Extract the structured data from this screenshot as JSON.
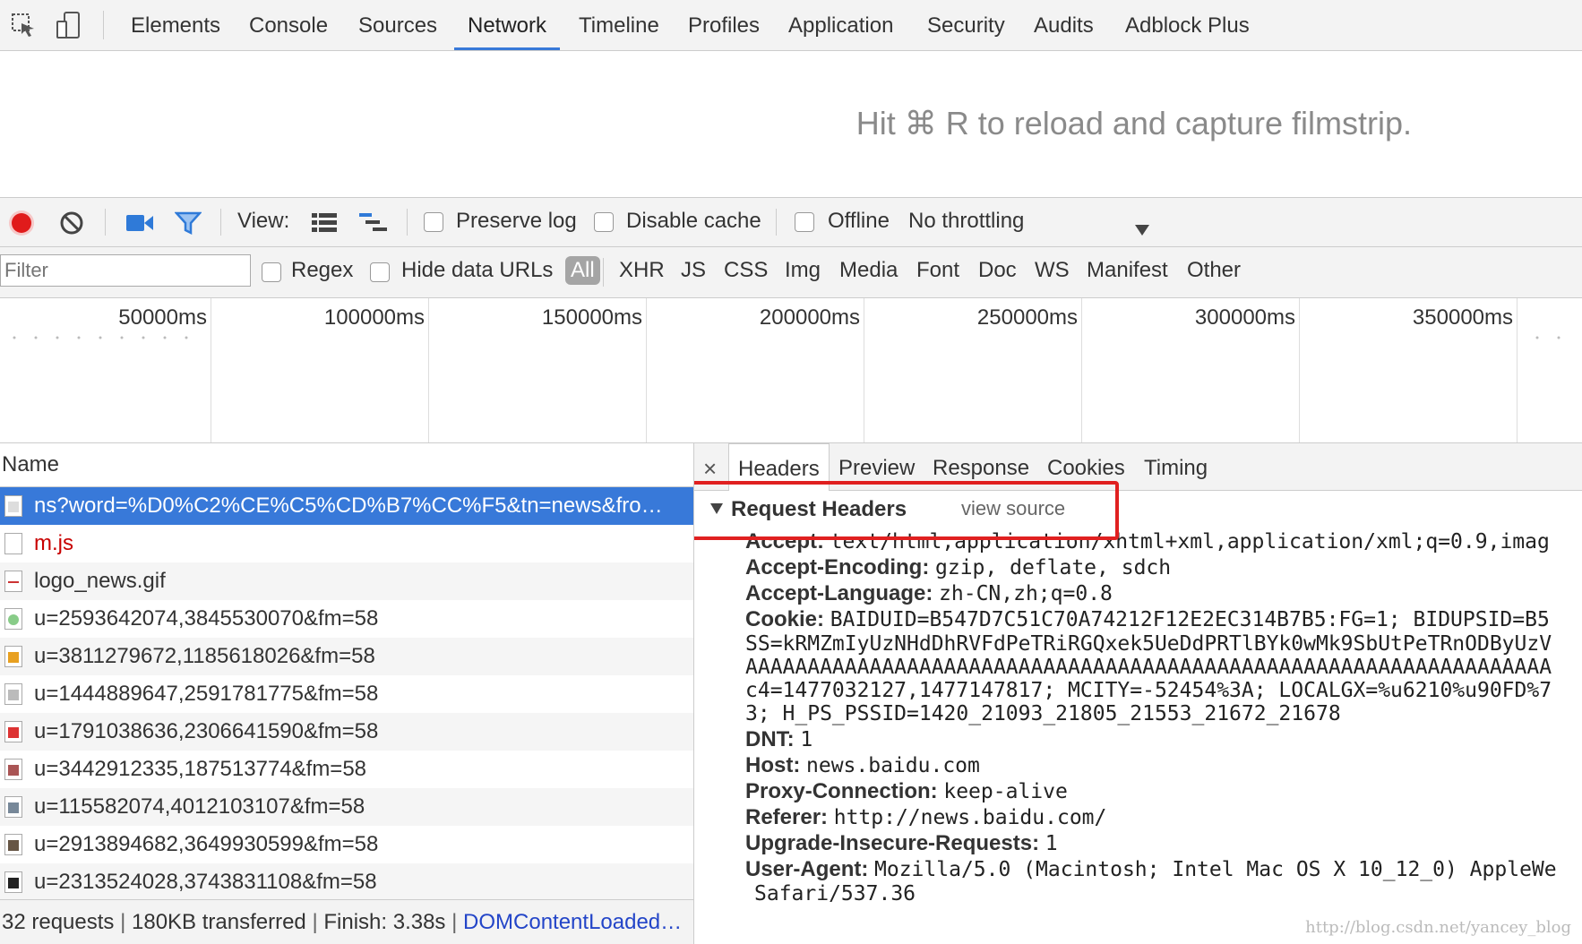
{
  "devtools_tabs": [
    "Elements",
    "Console",
    "Sources",
    "Network",
    "Timeline",
    "Profiles",
    "Application",
    "Security",
    "Audits",
    "Adblock Plus"
  ],
  "active_tab": "Network",
  "filmstrip_message": "Hit ⌘ R to reload and capture filmstrip.",
  "toolbar": {
    "view_label": "View:",
    "preserve_log": "Preserve log",
    "disable_cache": "Disable cache",
    "offline": "Offline",
    "throttling": "No throttling"
  },
  "filter": {
    "placeholder": "Filter",
    "regex": "Regex",
    "hide_data_urls": "Hide data URLs",
    "types": [
      "All",
      "XHR",
      "JS",
      "CSS",
      "Img",
      "Media",
      "Font",
      "Doc",
      "WS",
      "Manifest",
      "Other"
    ]
  },
  "timeline_ticks": [
    "50000ms",
    "100000ms",
    "150000ms",
    "200000ms",
    "250000ms",
    "300000ms",
    "350000ms"
  ],
  "request_list": {
    "header": "Name",
    "rows": [
      {
        "name": "ns?word=%D0%C2%CE%C5%CD%B7%CC%F5&tn=news&fro…",
        "selected": true
      },
      {
        "name": "m.js",
        "error": true
      },
      {
        "name": "logo_news.gif"
      },
      {
        "name": "u=2593642074,3845530070&fm=58"
      },
      {
        "name": "u=3811279672,1185618026&fm=58"
      },
      {
        "name": "u=1444889647,2591781775&fm=58"
      },
      {
        "name": "u=1791038636,2306641590&fm=58"
      },
      {
        "name": "u=3442912335,187513774&fm=58"
      },
      {
        "name": "u=115582074,4012103107&fm=58"
      },
      {
        "name": "u=2913894682,3649930599&fm=58"
      },
      {
        "name": "u=2313524028,3743831108&fm=58"
      }
    ],
    "status": {
      "requests": "32 requests",
      "transferred": "180KB transferred",
      "finish": "Finish: 3.38s",
      "dcl": "DOMContentLoaded…"
    }
  },
  "details": {
    "close": "×",
    "tabs": [
      "Headers",
      "Preview",
      "Response",
      "Cookies",
      "Timing"
    ],
    "active_tab": "Headers",
    "section_title": "Request Headers",
    "view_source": "view source",
    "headers": [
      {
        "key": "Accept:",
        "value": "text/html,application/xhtml+xml,application/xml;q=0.9,imag"
      },
      {
        "key": "Accept-Encoding:",
        "value": "gzip, deflate, sdch"
      },
      {
        "key": "Accept-Language:",
        "value": "zh-CN,zh;q=0.8"
      },
      {
        "key": "Cookie:",
        "value": "BAIDUID=B547D7C51C70A74212F12E2EC314B7B5:FG=1; BIDUPSID=B5"
      },
      {
        "key": "DNT:",
        "value": "1"
      },
      {
        "key": "Host:",
        "value": "news.baidu.com"
      },
      {
        "key": "Proxy-Connection:",
        "value": "keep-alive"
      },
      {
        "key": "Referer:",
        "value": "http://news.baidu.com/"
      },
      {
        "key": "Upgrade-Insecure-Requests:",
        "value": "1"
      },
      {
        "key": "User-Agent:",
        "value": "Mozilla/5.0 (Macintosh; Intel Mac OS X 10_12_0) AppleWe"
      }
    ],
    "cookie_continuation": [
      "SS=kRMZmIyUzNHdDhRVFdPeTRiRGQxek5UeDdPRTlBYk0wMk9SbUtPeTRnODByUzV",
      "AAAAAAAAAAAAAAAAAAAAAAAAAAAAAAAAAAAAAAAAAAAAAAAAAAAAAAAAAAAAAAAAA",
      "c4=1477032127,1477147817; MCITY=-52454%3A; LOCALGX=%u6210%u90FD%7",
      "3; H_PS_PSSID=1420_21093_21805_21553_21672_21678"
    ],
    "ua_continuation": "Safari/537.36"
  },
  "watermark": "http://blog.csdn.net/yancey_blog",
  "colors": {
    "accent": "#3879d9",
    "record": "#e01b1b",
    "highlight_box": "#e02020",
    "error_text": "#c80000",
    "link": "#2345c8"
  }
}
